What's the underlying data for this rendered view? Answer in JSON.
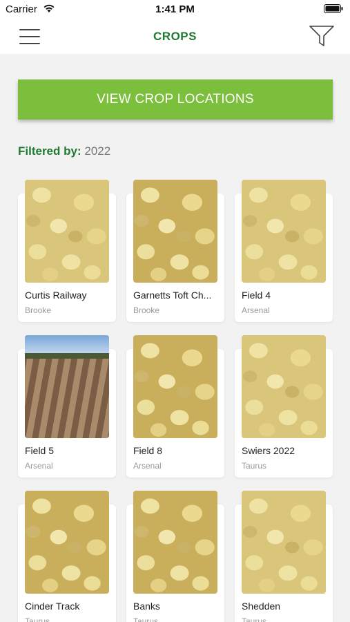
{
  "status_bar": {
    "carrier": "Carrier",
    "time": "1:41 PM"
  },
  "nav": {
    "title": "CROPS",
    "menu_icon": "hamburger-menu-icon",
    "filter_icon": "filter-funnel-icon"
  },
  "cta": {
    "label": "VIEW CROP LOCATIONS",
    "color": "#7bbf3c"
  },
  "filter": {
    "label": "Filtered by:",
    "value": "2022"
  },
  "brand_color": "#1f7a33",
  "crops": [
    {
      "name": "Curtis Railway",
      "variety": "Brooke",
      "image": "potato-chips"
    },
    {
      "name": "Garnetts Toft Ch...",
      "variety": "Brooke",
      "image": "potato-chips"
    },
    {
      "name": "Field 4",
      "variety": "Arsenal",
      "image": "potato-chips"
    },
    {
      "name": "Field 5",
      "variety": "Arsenal",
      "image": "ploughed-field"
    },
    {
      "name": "Field 8",
      "variety": "Arsenal",
      "image": "potato-chips"
    },
    {
      "name": "Swiers 2022",
      "variety": "Taurus",
      "image": "potato-chips"
    },
    {
      "name": "Cinder Track",
      "variety": "Taurus",
      "image": "potato-chips"
    },
    {
      "name": "Banks",
      "variety": "Taurus",
      "image": "potato-chips"
    },
    {
      "name": "Shedden",
      "variety": "Taurus",
      "image": "potato-chips"
    }
  ]
}
